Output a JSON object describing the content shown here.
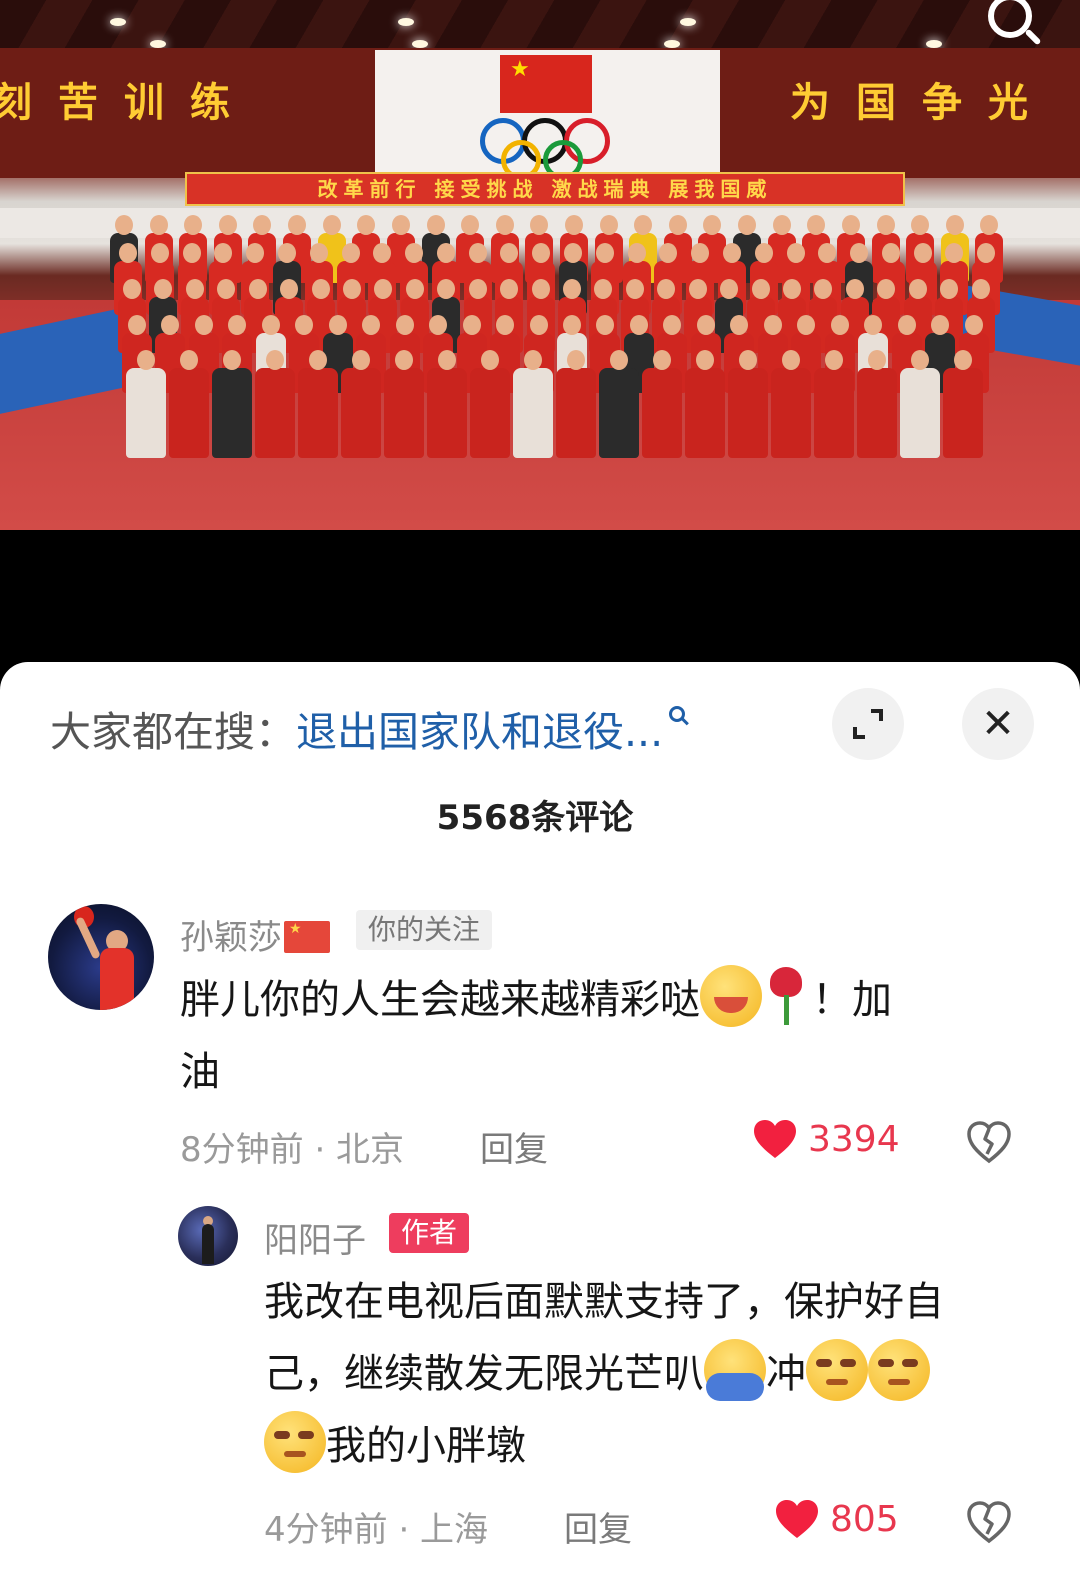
{
  "photo": {
    "wall_slogan_left": "刻苦训练",
    "wall_slogan_right": "为国争光",
    "banner_text": "改革前行 接受挑战 激战瑞典 展我国威"
  },
  "panel": {
    "search_prefix": "大家都在搜：",
    "search_query": "退出国家队和退役...",
    "comment_count": "5568条评论",
    "icons": {
      "search": "search-icon",
      "expand": "expand-icon",
      "close": "close-icon",
      "like": "heart-icon",
      "dislike": "broken-heart-icon"
    },
    "colors": {
      "accent_link": "#1f5fa8",
      "like_red": "#e8374e",
      "author_tag": "#ee3d5e"
    }
  },
  "comments": [
    {
      "username": "孙颖莎",
      "tag": "你的关注",
      "text_part1": "胖儿你的人生会越来越精彩哒",
      "text_part2": "！加",
      "text_part3": "油",
      "time_location": "8分钟前 · 北京",
      "reply_label": "回复",
      "likes": "3394"
    }
  ],
  "reply": {
    "username": "阳阳子",
    "tag": "作者",
    "text_line1": "我改在电视后面默默支持了，保护好自",
    "text_line2a": "己，继续散发无限光芒叭",
    "text_line2b": "冲",
    "text_line3": "我的小胖墩",
    "time_location": "4分钟前 · 上海",
    "reply_label": "回复",
    "likes": "805"
  }
}
